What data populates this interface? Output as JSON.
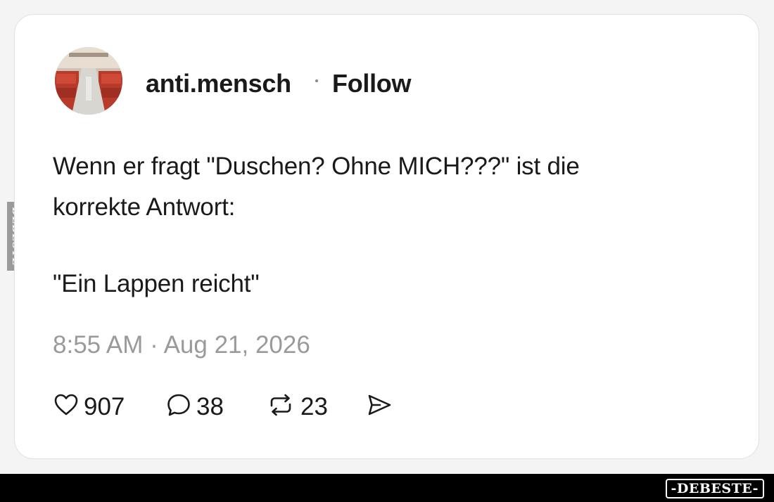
{
  "post": {
    "username": "anti.mensch",
    "separator": "·",
    "follow_label": "Follow",
    "text_lines": [
      "Wenn er fragt \"Duschen? Ohne MICH???\" ist die",
      "korrekte Antwort:",
      "\"Ein Lappen reicht\""
    ],
    "timestamp": "8:55 AM · Aug 21, 2026"
  },
  "actions": {
    "likes": "907",
    "comments": "38",
    "reposts": "23",
    "like_icon": "heart-icon",
    "comment_icon": "speech-bubble-icon",
    "repost_icon": "repost-arrows-icon",
    "share_icon": "send-icon"
  },
  "watermarks": {
    "side": "DEBESTE",
    "bottom": "-DEBESTE-"
  },
  "colors": {
    "card_background": "#ffffff",
    "text_primary": "#1a1a1a",
    "text_muted": "#9a9a9a",
    "footer_bar": "#000000"
  }
}
